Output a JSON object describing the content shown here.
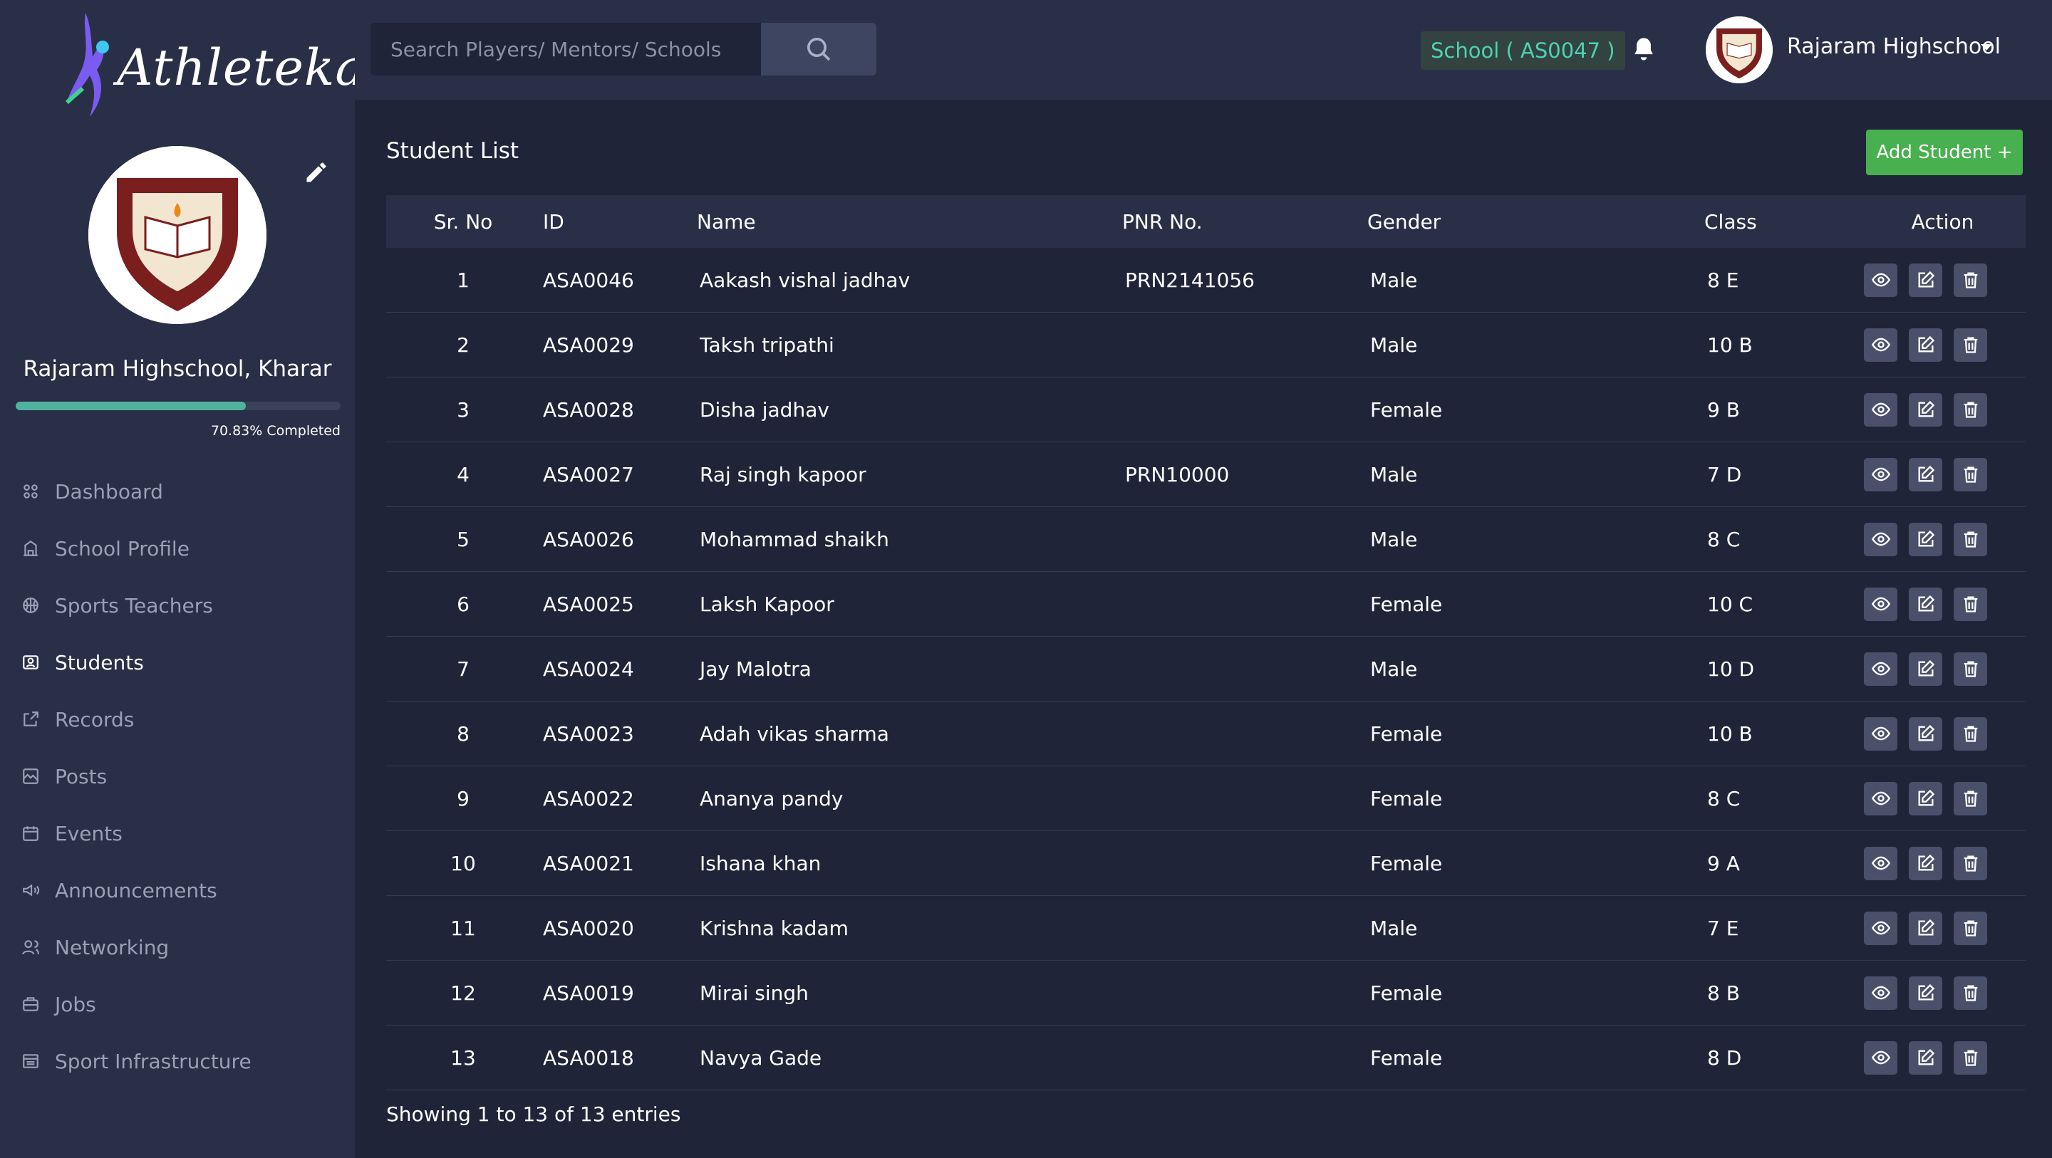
{
  "app": {
    "logo_text": "Athletekar"
  },
  "sidebar": {
    "school_name": "Rajaram Highschool, Kharar",
    "progress_label": "70.83% Completed",
    "progress_value": 70.83,
    "items": [
      {
        "label": "Dashboard",
        "icon": "dashboard-icon"
      },
      {
        "label": "School Profile",
        "icon": "building-icon"
      },
      {
        "label": "Sports Teachers",
        "icon": "basketball-icon"
      },
      {
        "label": "Students",
        "icon": "student-id-icon"
      },
      {
        "label": "Records",
        "icon": "records-icon"
      },
      {
        "label": "Posts",
        "icon": "posts-icon"
      },
      {
        "label": "Events",
        "icon": "calendar-icon"
      },
      {
        "label": "Announcements",
        "icon": "megaphone-icon"
      },
      {
        "label": "Networking",
        "icon": "people-icon"
      },
      {
        "label": "Jobs",
        "icon": "briefcase-icon"
      },
      {
        "label": "Sport Infrastructure",
        "icon": "infrastructure-icon"
      }
    ],
    "active_item": "Students"
  },
  "header": {
    "search_placeholder": "Search Players/ Mentors/ Schools",
    "school_badge": "School ( AS0047 )",
    "user_name": "Rajaram Highschool"
  },
  "main": {
    "title": "Student List",
    "add_button": "Add Student +",
    "columns": [
      "Sr. No",
      "ID",
      "Name",
      "PNR No.",
      "Gender",
      "Class",
      "Action"
    ],
    "rows": [
      {
        "sr": "1",
        "id": "ASA0046",
        "name": "Aakash vishal jadhav",
        "pnr": "PRN2141056",
        "gender": "Male",
        "class": "8 E"
      },
      {
        "sr": "2",
        "id": "ASA0029",
        "name": "Taksh tripathi",
        "pnr": "",
        "gender": "Male",
        "class": "10 B"
      },
      {
        "sr": "3",
        "id": "ASA0028",
        "name": "Disha jadhav",
        "pnr": "",
        "gender": "Female",
        "class": "9 B"
      },
      {
        "sr": "4",
        "id": "ASA0027",
        "name": "Raj singh kapoor",
        "pnr": "PRN10000",
        "gender": "Male",
        "class": "7 D"
      },
      {
        "sr": "5",
        "id": "ASA0026",
        "name": "Mohammad shaikh",
        "pnr": "",
        "gender": "Male",
        "class": "8 C"
      },
      {
        "sr": "6",
        "id": "ASA0025",
        "name": "Laksh Kapoor",
        "pnr": "",
        "gender": "Female",
        "class": "10 C"
      },
      {
        "sr": "7",
        "id": "ASA0024",
        "name": "Jay Malotra",
        "pnr": "",
        "gender": "Male",
        "class": "10 D"
      },
      {
        "sr": "8",
        "id": "ASA0023",
        "name": "Adah vikas sharma",
        "pnr": "",
        "gender": "Female",
        "class": "10 B"
      },
      {
        "sr": "9",
        "id": "ASA0022",
        "name": "Ananya pandy",
        "pnr": "",
        "gender": "Female",
        "class": "8 C"
      },
      {
        "sr": "10",
        "id": "ASA0021",
        "name": "Ishana khan",
        "pnr": "",
        "gender": "Female",
        "class": "9 A"
      },
      {
        "sr": "11",
        "id": "ASA0020",
        "name": "Krishna kadam",
        "pnr": "",
        "gender": "Male",
        "class": "7 E"
      },
      {
        "sr": "12",
        "id": "ASA0019",
        "name": "Mirai singh",
        "pnr": "",
        "gender": "Female",
        "class": "8 B"
      },
      {
        "sr": "13",
        "id": "ASA0018",
        "name": "Navya Gade",
        "pnr": "",
        "gender": "Female",
        "class": "8 D"
      }
    ],
    "footer": "Showing 1 to 13 of 13 entries"
  },
  "colors": {
    "background": "#1f2438",
    "panel": "#2a2f48",
    "accent_green": "#48b04e",
    "accent_teal": "#4fd1b2",
    "progress": "#4fb3a0"
  }
}
